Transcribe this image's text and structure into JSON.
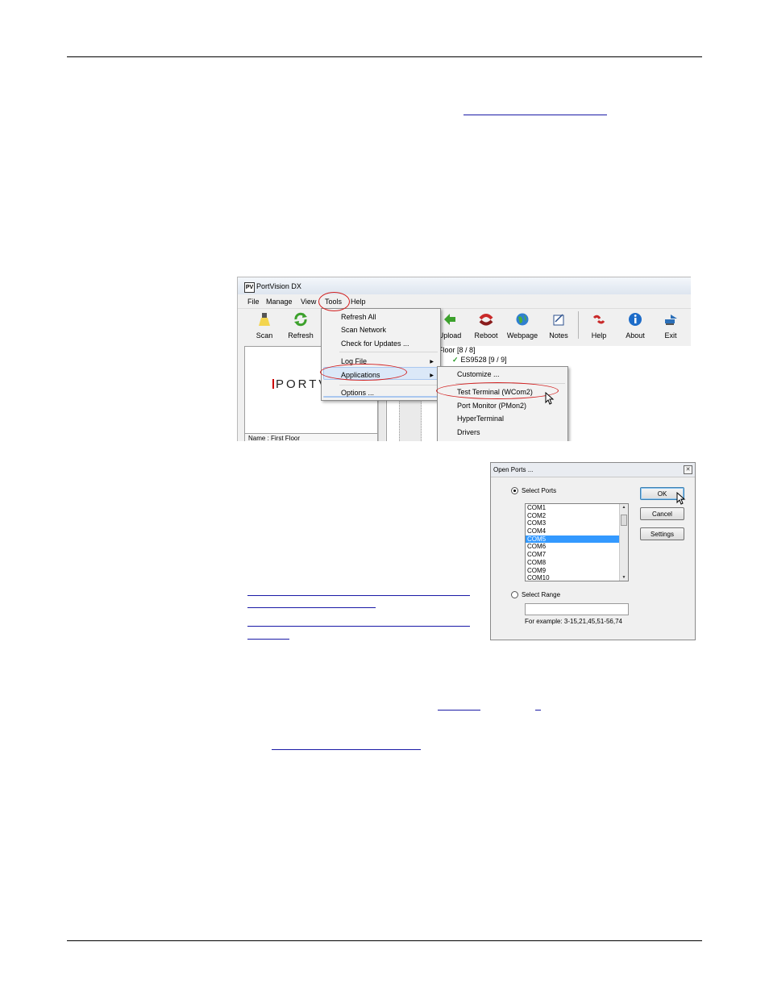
{
  "portvision": {
    "window_title": "PortVision DX",
    "app_icon": "PV",
    "menu": [
      "File",
      "Manage",
      "View",
      "Tools",
      "Help"
    ],
    "toolbar": [
      {
        "label": "Scan",
        "icon": "scan-icon"
      },
      {
        "label": "Refresh",
        "icon": "refresh-icon"
      },
      {
        "label": "Upload",
        "icon": "upload-icon"
      },
      {
        "label": "Reboot",
        "icon": "reboot-icon"
      },
      {
        "label": "Webpage",
        "icon": "webpage-icon"
      },
      {
        "label": "Notes",
        "icon": "notes-icon"
      },
      {
        "label": "Help",
        "icon": "help-icon"
      },
      {
        "label": "About",
        "icon": "about-icon"
      },
      {
        "label": "Exit",
        "icon": "exit-icon"
      }
    ],
    "tools_menu": {
      "items": [
        "Refresh All",
        "Scan Network",
        "Check for Updates ...",
        "Log File",
        "Applications",
        "Options ..."
      ],
      "highlighted": "Applications"
    },
    "applications_submenu": {
      "items": [
        "Customize ...",
        "Test Terminal (WCom2)",
        "Port Monitor (PMon2)",
        "HyperTerminal",
        "Drivers"
      ],
      "highlighted": "Test Terminal (WCom2)"
    },
    "logo_text": "PORTVI",
    "tree": {
      "floor": "t Floor [8 / 8]",
      "device": "ES9528 [9 / 9]"
    },
    "name_field": "Name : First Floor",
    "colors": {
      "highlight_oval": "#d21f1f",
      "selection": "#3399ff"
    }
  },
  "open_ports": {
    "title": "Open Ports ...",
    "close_glyph": "✕",
    "select_ports_label": "Select Ports",
    "ports": [
      "COM1",
      "COM2",
      "COM3",
      "COM4",
      "COM5",
      "COM6",
      "COM7",
      "COM8",
      "COM9",
      "COM10"
    ],
    "selected_port": "COM5",
    "select_range_label": "Select Range",
    "range_value": "",
    "example": "For example: 3-15,21,45,51-56,74",
    "buttons": {
      "ok": "OK",
      "cancel": "Cancel",
      "settings": "Settings"
    }
  }
}
